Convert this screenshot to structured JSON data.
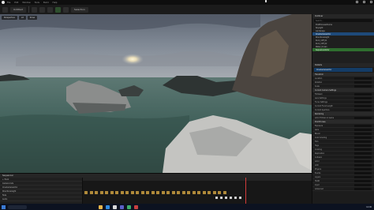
{
  "menubar": {
    "items": [
      "File",
      "Edit",
      "Window",
      "Tools",
      "Build",
      "Help"
    ]
  },
  "toolbar": {
    "level_tab": "Untitled",
    "mode_tab": "Selection"
  },
  "viewport": {
    "tabs": [
      "Perspective",
      "Lit",
      "Show"
    ]
  },
  "outliner": {
    "title": "Outliner",
    "search_placeholder": "Search...",
    "rows": [
      {
        "label": "PostProcessVolume",
        "state": "normal"
      },
      {
        "label": "SkyLight",
        "state": "normal"
      },
      {
        "label": "Landscape",
        "state": "normal"
      },
      {
        "label": "CineCameraActor",
        "state": "selected"
      },
      {
        "label": "DirectionalLight",
        "state": "normal"
      },
      {
        "label": "Rock_Cliff_01",
        "state": "normal"
      },
      {
        "label": "Rock_Cliff_02",
        "state": "normal"
      },
      {
        "label": "Water_Ocean",
        "state": "normal"
      },
      {
        "label": "SequencerActor",
        "state": "highlight"
      }
    ]
  },
  "details": {
    "title": "Details",
    "component": "CineCameraActor",
    "rows": [
      "Transform",
      "Location",
      "Rotation",
      "Scale",
      "Current Camera Settings",
      "Filmback",
      "Lens Settings",
      "Focus Settings",
      "Current Focal Length",
      "Current Aperture",
      "Rendering",
      "Actor Hidden In Game",
      "Post Process",
      "Exposure",
      "Lens",
      "Bloom",
      "Color Grading",
      "Film",
      "Tags",
      "Cooking",
      "Replication",
      "Collision",
      "Actor",
      "LOD",
      "Physics",
      "Events",
      "Layers",
      "HLOD",
      "Input",
      "Advanced"
    ]
  },
  "sequencer": {
    "title": "Sequencer",
    "tracks": [
      "+ Track",
      "Camera Cuts",
      "CineCameraActor",
      "DirectionalLight",
      "Fade",
      "Audio"
    ],
    "key_count": 28
  },
  "taskbar": {
    "time": "12:00"
  }
}
